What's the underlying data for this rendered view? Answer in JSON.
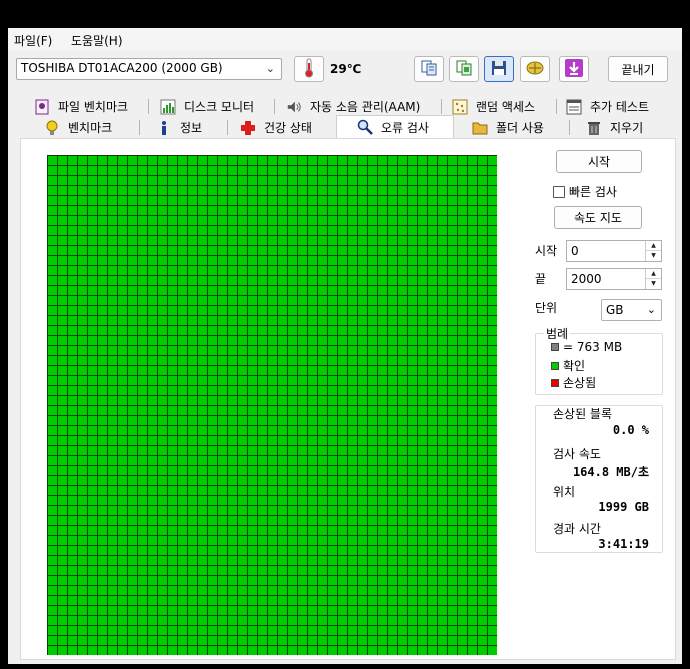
{
  "menu": {
    "file": "파일(F)",
    "help": "도움말(H)"
  },
  "toolbar": {
    "drive": "TOSHIBA DT01ACA200 (2000 GB)",
    "temperature": "29℃",
    "exit_label": "끝내기",
    "icons": [
      "thermometer-icon",
      "copy-info-icon",
      "copy-screenshot-icon",
      "save-icon",
      "scan-icon",
      "download-icon"
    ]
  },
  "tabs": {
    "row1": [
      {
        "label": "파일 벤치마크",
        "icon": "file-benchmark-icon"
      },
      {
        "label": "디스크 모니터",
        "icon": "disk-monitor-icon"
      },
      {
        "label": "자동 소음 관리(AAM)",
        "icon": "speaker-icon"
      },
      {
        "label": "랜덤 액세스",
        "icon": "random-access-icon"
      },
      {
        "label": "추가 테스트",
        "icon": "extra-tests-icon"
      }
    ],
    "row2": [
      {
        "label": "벤치마크",
        "icon": "lightbulb-icon"
      },
      {
        "label": "정보",
        "icon": "info-icon"
      },
      {
        "label": "건강 상태",
        "icon": "health-cross-icon"
      },
      {
        "label": "오류 검사",
        "icon": "magnifier-icon"
      },
      {
        "label": "폴더 사용",
        "icon": "folder-icon"
      },
      {
        "label": "지우기",
        "icon": "trash-icon"
      }
    ],
    "active": "오류 검사"
  },
  "scan": {
    "start_button": "시작",
    "quick_scan_label": "빠른 검사",
    "quick_scan_checked": false,
    "speed_map_button": "속도 지도",
    "start_label": "시작",
    "start_value": "0",
    "end_label": "끝",
    "end_value": "2000",
    "unit_label": "단위",
    "unit_value": "GB"
  },
  "legend": {
    "title": "범례",
    "block_size": "= 763 MB",
    "ok": "확인",
    "damaged": "손상됨",
    "colors": {
      "block": "#808080",
      "ok": "#00cc00",
      "damaged": "#ee0000"
    }
  },
  "stats": {
    "damaged_blocks_label": "손상된 블록",
    "damaged_blocks_value": "0.0 %",
    "scan_speed_label": "검사 속도",
    "scan_speed_value": "164.8 MB/초",
    "position_label": "위치",
    "position_value": "1999 GB",
    "elapsed_label": "경과 시간",
    "elapsed_value": "3:41:19"
  },
  "block_map": {
    "columns": 45,
    "rows": 50,
    "ok_color": "#00cc00",
    "line_color": "#004400",
    "status": "all-ok"
  }
}
